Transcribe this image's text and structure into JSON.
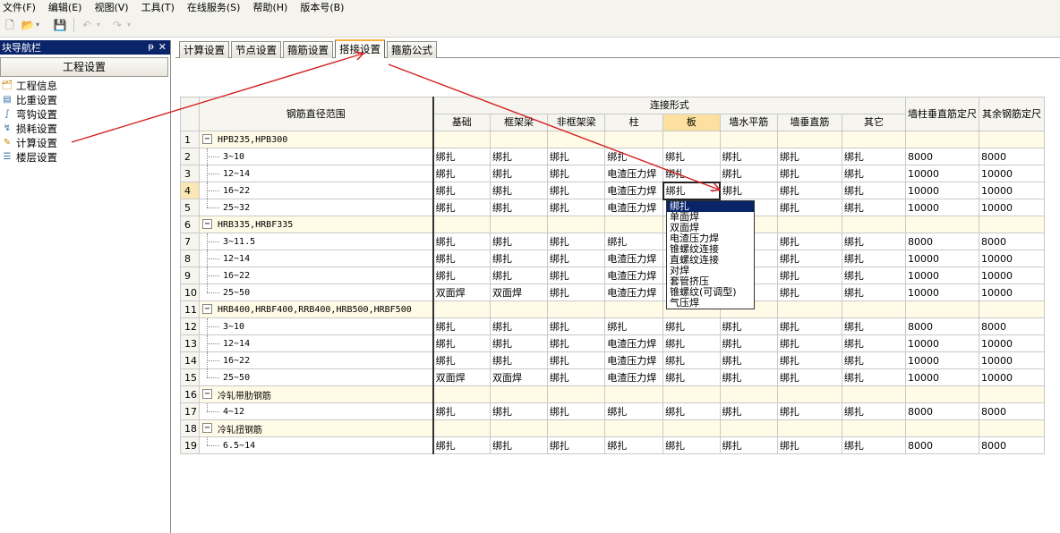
{
  "menu": [
    "文件(F)",
    "编辑(E)",
    "视图(V)",
    "工具(T)",
    "在线服务(S)",
    "帮助(H)",
    "版本号(B)"
  ],
  "nav": {
    "title": "块导航栏",
    "pin": "ᵽ",
    "close": "✕",
    "header_button": "工程设置",
    "items": [
      {
        "label": "工程信息",
        "icon": "project-info-icon"
      },
      {
        "label": "比重设置",
        "icon": "density-icon"
      },
      {
        "label": "弯钩设置",
        "icon": "hook-icon"
      },
      {
        "label": "损耗设置",
        "icon": "loss-icon"
      },
      {
        "label": "计算设置",
        "icon": "calc-settings-icon"
      },
      {
        "label": "楼层设置",
        "icon": "floor-icon"
      }
    ]
  },
  "tabs": [
    "计算设置",
    "节点设置",
    "箍筋设置",
    "搭接设置",
    "箍筋公式"
  ],
  "active_tab": 3,
  "grid": {
    "header_range": "钢筋直径范围",
    "header_group": "连接形式",
    "header_cols": [
      "基础",
      "框架梁",
      "非框架梁",
      "柱",
      "板",
      "墙水平筋",
      "墙垂直筋",
      "其它"
    ],
    "header_col9": "墙柱垂直筋定尺",
    "header_col10": "其余钢筋定尺",
    "rows": [
      {
        "n": "1",
        "group": true,
        "label": "HPB235,HPB300"
      },
      {
        "n": "2",
        "label": "3~10",
        "cells": [
          "绑扎",
          "绑扎",
          "绑扎",
          "绑扎",
          "绑扎",
          "绑扎",
          "绑扎",
          "绑扎",
          "8000",
          "8000"
        ]
      },
      {
        "n": "3",
        "label": "12~14",
        "cells": [
          "绑扎",
          "绑扎",
          "绑扎",
          "电渣压力焊",
          "绑扎",
          "绑扎",
          "绑扎",
          "绑扎",
          "10000",
          "10000"
        ]
      },
      {
        "n": "4",
        "label": "16~22",
        "cells": [
          "绑扎",
          "绑扎",
          "绑扎",
          "电渣压力焊",
          "绑扎",
          "绑扎",
          "绑扎",
          "绑扎",
          "10000",
          "10000"
        ]
      },
      {
        "n": "5",
        "label": "25~32",
        "last": true,
        "cells": [
          "绑扎",
          "绑扎",
          "绑扎",
          "电渣压力焊",
          "",
          "绑扎",
          "绑扎",
          "绑扎",
          "10000",
          "10000"
        ]
      },
      {
        "n": "6",
        "group": true,
        "label": "HRB335,HRBF335"
      },
      {
        "n": "7",
        "label": "3~11.5",
        "cells": [
          "绑扎",
          "绑扎",
          "绑扎",
          "绑扎",
          "",
          "绑扎",
          "绑扎",
          "绑扎",
          "8000",
          "8000"
        ]
      },
      {
        "n": "8",
        "label": "12~14",
        "cells": [
          "绑扎",
          "绑扎",
          "绑扎",
          "电渣压力焊",
          "",
          "绑扎",
          "绑扎",
          "绑扎",
          "10000",
          "10000"
        ]
      },
      {
        "n": "9",
        "label": "16~22",
        "cells": [
          "绑扎",
          "绑扎",
          "绑扎",
          "电渣压力焊",
          "",
          "绑扎",
          "绑扎",
          "绑扎",
          "10000",
          "10000"
        ]
      },
      {
        "n": "10",
        "label": "25~50",
        "last": true,
        "cells": [
          "双面焊",
          "双面焊",
          "绑扎",
          "电渣压力焊",
          "",
          "绑扎",
          "绑扎",
          "绑扎",
          "10000",
          "10000"
        ]
      },
      {
        "n": "11",
        "group": true,
        "label": "HRB400,HRBF400,RRB400,HRB500,HRBF500"
      },
      {
        "n": "12",
        "label": "3~10",
        "cells": [
          "绑扎",
          "绑扎",
          "绑扎",
          "绑扎",
          "绑扎",
          "绑扎",
          "绑扎",
          "绑扎",
          "8000",
          "8000"
        ]
      },
      {
        "n": "13",
        "label": "12~14",
        "cells": [
          "绑扎",
          "绑扎",
          "绑扎",
          "电渣压力焊",
          "绑扎",
          "绑扎",
          "绑扎",
          "绑扎",
          "10000",
          "10000"
        ]
      },
      {
        "n": "14",
        "label": "16~22",
        "cells": [
          "绑扎",
          "绑扎",
          "绑扎",
          "电渣压力焊",
          "绑扎",
          "绑扎",
          "绑扎",
          "绑扎",
          "10000",
          "10000"
        ]
      },
      {
        "n": "15",
        "label": "25~50",
        "last": true,
        "cells": [
          "双面焊",
          "双面焊",
          "绑扎",
          "电渣压力焊",
          "绑扎",
          "绑扎",
          "绑扎",
          "绑扎",
          "10000",
          "10000"
        ]
      },
      {
        "n": "16",
        "group": true,
        "label": "冷轧带肋钢筋"
      },
      {
        "n": "17",
        "label": "4~12",
        "last": true,
        "cells": [
          "绑扎",
          "绑扎",
          "绑扎",
          "绑扎",
          "绑扎",
          "绑扎",
          "绑扎",
          "绑扎",
          "8000",
          "8000"
        ]
      },
      {
        "n": "18",
        "group": true,
        "label": "冷轧扭钢筋"
      },
      {
        "n": "19",
        "label": "6.5~14",
        "last": true,
        "cells": [
          "绑扎",
          "绑扎",
          "绑扎",
          "绑扎",
          "绑扎",
          "绑扎",
          "绑扎",
          "绑扎",
          "8000",
          "8000"
        ]
      }
    ],
    "edit_value": "绑扎"
  },
  "dropdown_options": [
    "绑扎",
    "单面焊",
    "双面焊",
    "电渣压力焊",
    "锥螺纹连接",
    "直螺纹连接",
    "对焊",
    "套管挤压",
    "锥螺纹(可调型)",
    "气压焊"
  ],
  "dropdown_selected": 0,
  "annotation_color": "#d42020"
}
